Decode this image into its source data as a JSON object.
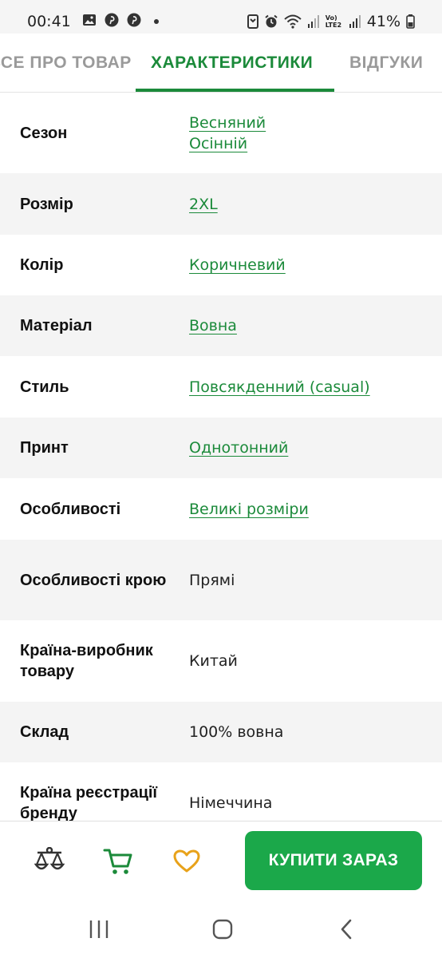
{
  "status_bar": {
    "time": "00:41",
    "battery": "41%",
    "network_label": "Vo) LTE2"
  },
  "tabs": [
    {
      "label": "ВСЕ ПРО ТОВАР",
      "active": false
    },
    {
      "label": "ХАРАКТЕРИСТИКИ",
      "active": true
    },
    {
      "label": "ВІДГУКИ",
      "active": false
    }
  ],
  "specs": [
    {
      "label": "Сезон",
      "values": [
        "Весняний",
        "Осінній"
      ],
      "link": true
    },
    {
      "label": "Розмір",
      "values": [
        "2XL"
      ],
      "link": true
    },
    {
      "label": "Колір",
      "values": [
        "Коричневий"
      ],
      "link": true
    },
    {
      "label": "Матеріал",
      "values": [
        "Вовна"
      ],
      "link": true
    },
    {
      "label": "Стиль",
      "values": [
        "Повсякденний (casual)"
      ],
      "link": true
    },
    {
      "label": "Принт",
      "values": [
        "Однотонний"
      ],
      "link": true
    },
    {
      "label": "Особливості",
      "values": [
        "Великі розміри"
      ],
      "link": true
    },
    {
      "label": "Особливості крою",
      "values": [
        "Прямі"
      ],
      "link": false
    },
    {
      "label": "Країна-виробник товару",
      "values": [
        "Китай"
      ],
      "link": false
    },
    {
      "label": "Склад",
      "values": [
        "100% вовна"
      ],
      "link": false
    },
    {
      "label": "Країна реєстрації бренду",
      "values": [
        "Німеччина"
      ],
      "link": false
    }
  ],
  "action_bar": {
    "buy_label": "КУПИТИ ЗАРАЗ",
    "icons": [
      "compare-scales-icon",
      "cart-icon",
      "heart-icon"
    ]
  },
  "colors": {
    "accent": "#1b8a3a",
    "buy_button": "#1ba84a",
    "favorite": "#e8a21a",
    "row_alt": "#f4f4f4"
  },
  "nav_bar": {
    "buttons": [
      "recent-apps",
      "home",
      "back"
    ]
  }
}
